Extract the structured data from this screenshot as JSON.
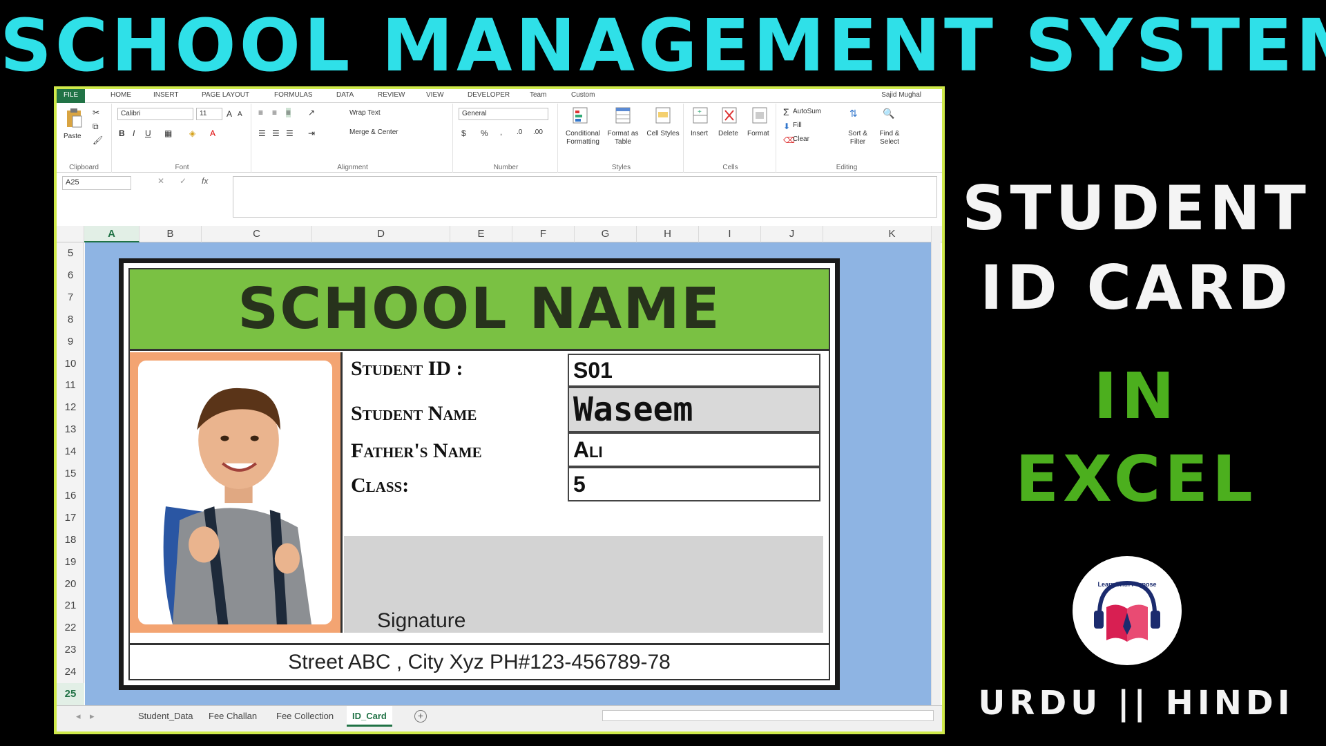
{
  "thumbnail": {
    "title": "SCHOOL MANAGEMENT SYSTEM",
    "side_line1": "STUDENT",
    "side_line2": "ID CARD",
    "side_line3": "IN",
    "side_line4": "EXCEL",
    "language": "URDU || HINDI",
    "logo_text": "Learn With Purpose",
    "colors": {
      "title": "#2fe0e8",
      "accent": "#4caf1e",
      "background": "#000000"
    }
  },
  "excel": {
    "ribbon_tabs": [
      "FILE",
      "HOME",
      "INSERT",
      "PAGE LAYOUT",
      "FORMULAS",
      "DATA",
      "REVIEW",
      "VIEW",
      "DEVELOPER",
      "Team",
      "Custom"
    ],
    "user": "Sajid Mughal",
    "ribbon": {
      "clipboard": {
        "paste": "Paste",
        "label": "Clipboard"
      },
      "font": {
        "name": "Calibri",
        "size": "11",
        "label": "Font"
      },
      "alignment": {
        "wrap_text": "Wrap Text",
        "merge_center": "Merge & Center",
        "label": "Alignment"
      },
      "number": {
        "format": "General",
        "label": "Number"
      },
      "styles": {
        "conditional": "Conditional Formatting",
        "format_table": "Format as Table",
        "cell_styles": "Cell Styles",
        "label": "Styles"
      },
      "cells": {
        "insert": "Insert",
        "delete": "Delete",
        "format": "Format",
        "label": "Cells"
      },
      "editing": {
        "autosum": "AutoSum",
        "fill": "Fill",
        "clear": "Clear",
        "sort_filter": "Sort & Filter",
        "find_select": "Find & Select",
        "label": "Editing"
      }
    },
    "name_box": "A25",
    "columns": [
      "A",
      "B",
      "C",
      "D",
      "E",
      "F",
      "G",
      "H",
      "I",
      "J",
      "K"
    ],
    "rows": [
      "5",
      "6",
      "7",
      "8",
      "9",
      "10",
      "11",
      "12",
      "13",
      "14",
      "15",
      "16",
      "17",
      "18",
      "19",
      "20",
      "21",
      "22",
      "23",
      "24",
      "25"
    ],
    "active_cell": {
      "column": "A",
      "row": "25"
    },
    "sheet_tabs": [
      "Student_Data",
      "Fee Challan",
      "Fee Collection",
      "ID_Card"
    ],
    "active_sheet": "ID_Card"
  },
  "card": {
    "school_name": "SCHOOL NAME",
    "fields": [
      {
        "label": "Student ID :",
        "value": "S01"
      },
      {
        "label": "Student Name",
        "value": "Waseem"
      },
      {
        "label": "Father's Name",
        "value": "Ali"
      },
      {
        "label": "Class:",
        "value": "5"
      }
    ],
    "signature_label": "Signature",
    "footer": "Street ABC , City Xyz PH#123-456789-78",
    "colors": {
      "header": "#7ac143",
      "photo_frame": "#f3a472",
      "sheet_bg": "#8eb4e3"
    }
  }
}
